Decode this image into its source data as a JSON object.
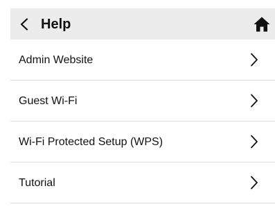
{
  "header": {
    "title": "Help",
    "back_icon": "chevron-left-icon",
    "home_icon": "home-icon"
  },
  "menu": {
    "items": [
      {
        "label": "Admin Website",
        "icon": "chevron-right-icon"
      },
      {
        "label": "Guest Wi-Fi",
        "icon": "chevron-right-icon"
      },
      {
        "label": "Wi-Fi Protected Setup (WPS)",
        "icon": "chevron-right-icon"
      },
      {
        "label": "Tutorial",
        "icon": "chevron-right-icon"
      }
    ]
  },
  "colors": {
    "header_background": "#ececec",
    "divider": "#dcdcdc",
    "text": "#111111",
    "background": "#ffffff"
  }
}
